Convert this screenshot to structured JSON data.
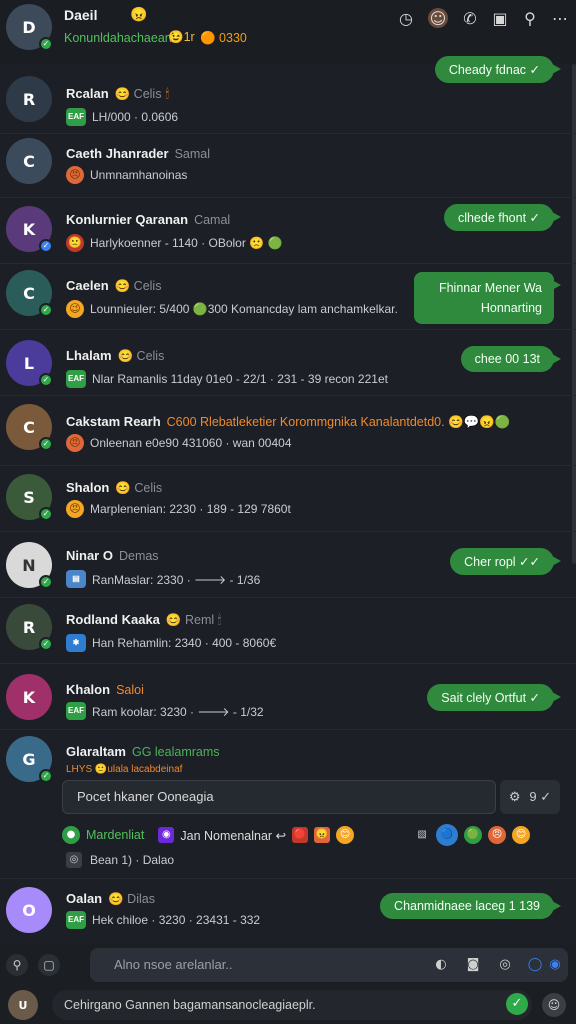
{
  "header": {
    "title": "Daeil",
    "title_emoji": "😠",
    "subtitle": "Konunldahachaean :",
    "sub_badge": "😉1r",
    "sub_count": "🟠 0330",
    "icons": [
      "clock-icon",
      "avatar-icon",
      "call-icon",
      "window-icon",
      "link-icon",
      "more-icon"
    ]
  },
  "chats": [
    {
      "name": "Rcalan",
      "tag": "😊 Celis",
      "extra": "🕯",
      "preview": "LH/000 · 0.0606",
      "badge": "EAF",
      "badge_color": "#2f9e44",
      "avatar_color": "#2f3a48",
      "avatar_text": "R"
    },
    {
      "name": "Caeth Jhanrader",
      "tag": "Samal",
      "preview": "Unmnamhanoinas",
      "badge": "😠",
      "badge_color": "#e0673a",
      "avatar_color": "#3b4b5c",
      "avatar_text": "C"
    },
    {
      "name": "Konlurnier Qaranan",
      "tag": "Camal",
      "preview": "Harlykoenner - 1140 · OBolor 🙁 🟢",
      "badge": "🙁",
      "badge_color": "#c0392b",
      "avatar_color": "#5a3a7a",
      "avatar_text": "K"
    },
    {
      "name": "Caelen",
      "tag": "😊 Celis",
      "preview": "Lounnieuler: 5/400 🟢300 Komancday lam anchamkelkar.",
      "badge": "😉",
      "badge_color": "#f5a623",
      "avatar_color": "#2a5d5a",
      "avatar_text": "C"
    },
    {
      "name": "Lhalam",
      "tag": "😊 Celis",
      "preview": "Nlar Ramanlis 11day 01e0 - 22/1 · 231 - 39 recon 221et",
      "badge": "EAF",
      "badge_color": "#2f9e44",
      "avatar_color": "#4b3b9b",
      "avatar_text": "L"
    },
    {
      "name": "Cakstam Rearh",
      "tag": "C600 Rlebatleketier Korommgnika Kanalantdetd0. 😊💬😠🟢",
      "preview": "Onleenan e0e90 431060 · wan 00404",
      "badge": "😠",
      "badge_color": "#e0673a",
      "avatar_color": "#7a5a3a",
      "avatar_text": "C"
    },
    {
      "name": "Shalon",
      "tag": "😊 Celis",
      "preview": "Marplenenian: 2230 · 189 - 129 7860t",
      "badge": "😠",
      "badge_color": "#f5a623",
      "avatar_color": "#3a5a3a",
      "avatar_text": "S"
    },
    {
      "name": "Ninar O",
      "tag": "Demas",
      "preview": "RanMaslar: 2330 · 🡒 - 1/36",
      "badge": "▤",
      "badge_color": "#4a86c8",
      "avatar_color": "#d9d9d9",
      "avatar_text": "N"
    },
    {
      "name": "Rodland Kaaka",
      "tag": "😊 Reml 🕯",
      "preview": "Han Rehamlin: 2340 · 400 - 8060€",
      "badge": "✱",
      "badge_color": "#2f7dd1",
      "avatar_color": "#3a4a3a",
      "avatar_text": "R"
    },
    {
      "name": "Khalon",
      "tag": "Saloi",
      "preview": "Ram koolar: 3230 · 🡒 - 1/32",
      "badge": "EAF",
      "badge_color": "#2f9e44",
      "avatar_color": "#a0306a",
      "avatar_text": "K"
    },
    {
      "name": "Glaraltam",
      "tag": "GG lealamrams",
      "preview": "LHYS 🙁ulala lacabdeinaf",
      "badge": "🙁",
      "badge_color": "#c0392b",
      "avatar_color": "#3a6a8a",
      "avatar_text": "G"
    }
  ],
  "bubbles": [
    "Cheady fdnac ✓",
    "clhede fhont ✓",
    "Fhinnar Mener Wa Honnarting",
    "chee 00 13t",
    "Cher ropl ✓✓",
    "Sait clely Ortfut ✓"
  ],
  "reply": {
    "placeholder": "Pocet hkaner Ooneagia",
    "tool1": "⚙",
    "tool2": "9 ✓"
  },
  "reactions": {
    "label_green": "Mardenliat",
    "label": "Jan Nomenalnar ↩",
    "emojis": [
      "🔴",
      "😠",
      "😊"
    ],
    "emojis2": [
      "🔵",
      "🟢",
      "😠",
      "😊"
    ]
  },
  "under": {
    "badge": "◎",
    "text": "Bean 1) · Dalao"
  },
  "last_chat": {
    "name": "Oalan",
    "tag": "😊 Dilas",
    "preview": "Hek chiloe · 3230 · 23431 - 332",
    "badge": "EAF",
    "bubble": "Chanmidnaee laceg 1 139"
  },
  "bottom": {
    "placeholder": "Alno nsoe arelanlar..",
    "left_icons": [
      "🔍",
      "⬜"
    ],
    "tools": [
      "◐",
      "📷",
      "◎",
      "🔵",
      "🔵"
    ]
  },
  "compose": {
    "text": "Cehirgano Gannen bagamansanocleagiaeplr.",
    "send": "✓",
    "emoji": "☺"
  }
}
